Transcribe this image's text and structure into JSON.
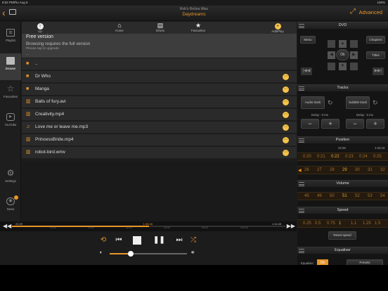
{
  "status": {
    "time": "8:52 PM",
    "date": "Thu Aug 6",
    "battery": "100%"
  },
  "header": {
    "subtitle": "Rob's Retina iMac",
    "title": "Daydreams",
    "advanced_label": "Advanced"
  },
  "sidebar": {
    "items": [
      {
        "label": "Playlist",
        "icon": "playlist-icon"
      },
      {
        "label": "Browse",
        "icon": "folder-icon",
        "active": true
      },
      {
        "label": "Favourites",
        "icon": "star-icon"
      },
      {
        "label": "YouTube",
        "icon": "youtube-icon"
      },
      {
        "label": "Settings",
        "icon": "gear-icon"
      },
      {
        "label": "News",
        "icon": "news-icon"
      }
    ]
  },
  "toolbar": {
    "up": "Up",
    "home": "Home",
    "drives": "Drives",
    "favourites": "Favourites",
    "addplay": "Add/Play"
  },
  "notice": {
    "title": "Free version",
    "message": "Browsing requires the full version",
    "hint": "Please tap to upgrade",
    "extra": "..."
  },
  "files": [
    {
      "name": "..",
      "type": "folder",
      "options": false
    },
    {
      "name": "Dr Who",
      "type": "folder",
      "options": true
    },
    {
      "name": "Manga",
      "type": "folder",
      "options": true
    },
    {
      "name": "Balls of fury.avi",
      "type": "video",
      "options": true
    },
    {
      "name": "Creativity.mp4",
      "type": "video",
      "options": true
    },
    {
      "name": "Love me or leave me.mp3",
      "type": "audio",
      "options": true
    },
    {
      "name": "PrincessBride.mp4",
      "type": "video",
      "options": true
    },
    {
      "name": "robot-bird.wmv",
      "type": "video",
      "options": true
    }
  ],
  "dvd": {
    "title": "DVD",
    "menu": "Menu",
    "chapters": "Chapters",
    "ok": "Ok",
    "titles": "Titles"
  },
  "tracks": {
    "title": "Tracks",
    "audio": "Audio track",
    "subtitle": "Subtitle track",
    "delay_audio": "Delay : 0 ms",
    "delay_sub": "Delay : 0 ms",
    "minus": "−",
    "plus": "+"
  },
  "position": {
    "title": "Position",
    "start": "22:29",
    "end": "1:34:18",
    "values": [
      "26",
      "27",
      "28",
      "29",
      "30",
      "31",
      "32"
    ],
    "selected": "29",
    "times": [
      "0:20",
      "0:21",
      "0:22",
      "0:23",
      "0:24",
      "0:25"
    ],
    "selected_time": "0:22"
  },
  "volume": {
    "title": "Volume",
    "values": [
      "45",
      "49",
      "50",
      "51",
      "52",
      "53",
      "54"
    ],
    "selected": "51"
  },
  "speed": {
    "title": "Speed",
    "values": [
      "0.25",
      "0.5",
      "0.75",
      "1",
      "1.1",
      "1.25",
      "1.5"
    ],
    "selected": "1",
    "reset": "Reset speed"
  },
  "equaliser": {
    "title": "Equaliser",
    "label": "Equaliser",
    "state": "On",
    "presets": "Presets"
  },
  "playback": {
    "current": "22:29",
    "position": "1:34:18",
    "end": "1:11:48",
    "progress": 0.5,
    "ticks": [
      "10:00",
      "20:00",
      "30:00",
      "40:00",
      "50:00",
      "1:00:00"
    ],
    "volume": 0.27
  }
}
